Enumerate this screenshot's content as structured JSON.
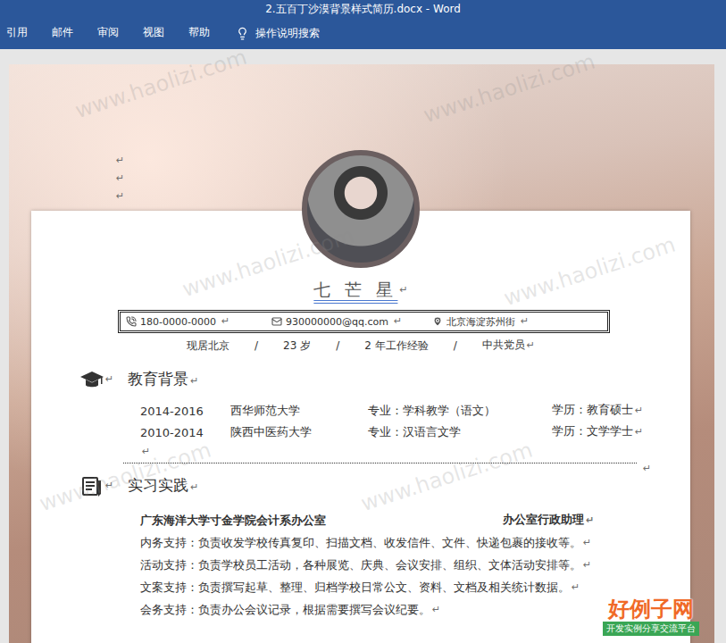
{
  "window": {
    "title": "2.五百丁沙漠背景样式简历.docx  -  Word"
  },
  "ribbon": {
    "tabs": [
      {
        "label": "引用",
        "selected": false
      },
      {
        "label": "邮件",
        "selected": false
      },
      {
        "label": "审阅",
        "selected": false
      },
      {
        "label": "视图",
        "selected": false
      },
      {
        "label": "帮助",
        "selected": false
      }
    ],
    "search": "操作说明搜索"
  },
  "watermark": "www.haolizi.com",
  "paragraph_mark": "↵",
  "cover_marks": [
    "↵",
    "↵",
    "↵"
  ],
  "resume": {
    "name": "七 芒 星",
    "contacts": [
      {
        "kind": "phone",
        "text": "180-0000-0000"
      },
      {
        "kind": "mail",
        "text": "930000000@qq.com"
      },
      {
        "kind": "location",
        "text": "北京海淀苏州街"
      }
    ],
    "info": [
      "现居北京",
      "23 岁",
      "2 年工作经验",
      "中共党员"
    ],
    "info_separator": "/",
    "education": {
      "title": "教育背景",
      "rows": [
        {
          "period": "2014-2016",
          "school": "西华师范大学",
          "major": "专业：学科教学（语文）",
          "degree": "学历：教育硕士"
        },
        {
          "period": "2010-2014",
          "school": "陕西中医药大学",
          "major": "专业：汉语言文学",
          "degree": "学历：文学学士"
        }
      ]
    },
    "practice": {
      "title": "实习实践",
      "org": "广东海洋大学寸金学院会计系办公室",
      "role": "办公室行政助理",
      "items": [
        "内务支持：负责收发学校传真复印、扫描文档、收发信件、文件、快递包裹的接收等。",
        "活动支持：负责学校员工活动，各种展览、庆典、会议安排、组织、文体活动安排等。",
        "文案支持：负责撰写起草、整理、归档学校日常公文、资料、文档及相关统计数据。",
        "会务支持：负责办公会议记录，根据需要撰写会议纪要。"
      ]
    }
  },
  "logo": {
    "title": "好例子网",
    "subtitle": "开发实例分享交流平台"
  }
}
